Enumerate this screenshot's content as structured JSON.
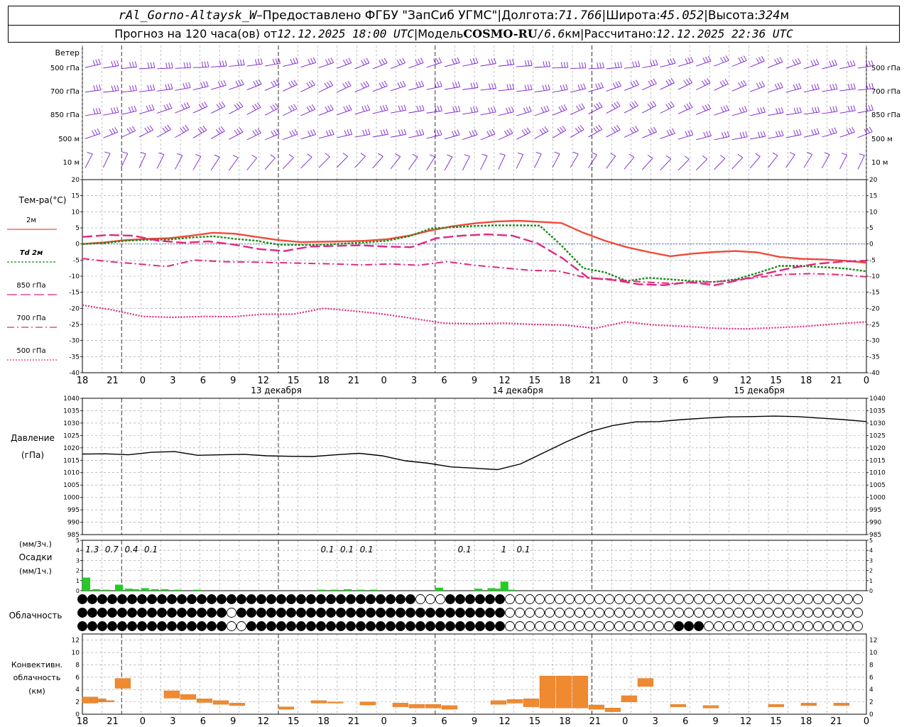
{
  "header": {
    "station": "rAl_Gorno-Altaysk_W",
    "dash": " – ",
    "provider": "Предоставлено ФГБУ \"ЗапСиб УГМС\"",
    "sep": " | ",
    "lon_label": "Долгота: ",
    "lon_value": "71.766",
    "lat_label": "Широта: ",
    "lat_value": "45.052",
    "alt_label": "Высота: ",
    "alt_value": "324",
    "alt_unit": "м",
    "forecast_prefix": "Прогноз на 120 часа(ов) от ",
    "forecast_time": "12.12.2025 18:00 UTC",
    "model_label": "Модель ",
    "model_name": "COSMO-RU",
    "model_res_sep": " / ",
    "model_res": "6.6",
    "model_res_unit": "км",
    "calc_label": "Рассчитано: ",
    "calc_time": "12.12.2025 22:36 UTC"
  },
  "colors": {
    "wind": "#7b1fd1",
    "t2m": "#f04a3a",
    "td2m": "#1a8a1a",
    "t850": "#e0287e",
    "t700": "#e0287e",
    "t500": "#e0287e",
    "pressure": "#000000",
    "precip": "#22cc22",
    "conv": "#f08a30",
    "grid": "#9a9a9a"
  },
  "time_axis": {
    "top_ticks": [
      "18",
      "21",
      "0",
      "3",
      "6",
      "9",
      "12",
      "15",
      "18",
      "21",
      "0",
      "3",
      "6",
      "9",
      "12",
      "15",
      "18",
      "21",
      "0",
      "3",
      "6",
      "9",
      "12",
      "15",
      "18",
      "21",
      "0"
    ],
    "bottom_ticks": [
      "18",
      "21",
      "0",
      "3",
      "6",
      "9",
      "12",
      "15",
      "18",
      "21",
      "0",
      "3",
      "6",
      "9",
      "12",
      "15",
      "18",
      "21",
      "0",
      "3",
      "6",
      "9",
      "12",
      "15",
      "18",
      "21",
      "0"
    ],
    "days": [
      "13 декабря",
      "14 декабря",
      "15 декабря"
    ]
  },
  "chart_data": [
    {
      "type": "wind-barbs",
      "title": "Ветер",
      "levels": [
        "500 гПа",
        "700 гПа",
        "850 гПа",
        "500 м",
        "10 м"
      ],
      "x_hours": [
        0,
        120
      ]
    },
    {
      "type": "line",
      "title": "Тем-ра(°C)",
      "ylim": [
        -40,
        20
      ],
      "yticks": [
        "20",
        "15",
        "10",
        "5",
        "0",
        "-5",
        "-10",
        "-15",
        "-20",
        "-25",
        "-30",
        "-35",
        "-40"
      ],
      "legend": [
        "2м",
        "Td  2м",
        "850 гПа",
        "700 гПа",
        "500 гПа"
      ],
      "x_hours": [
        0,
        3,
        6,
        9,
        12,
        15,
        18,
        21,
        24,
        27,
        30,
        33,
        36,
        39,
        42,
        45,
        48,
        51,
        54,
        57,
        60,
        63,
        66,
        69,
        72,
        75,
        78,
        81,
        84,
        87,
        90,
        93,
        96,
        99,
        102,
        105,
        108,
        111,
        114,
        117,
        120
      ],
      "series": [
        {
          "name": "2м",
          "values": [
            0,
            0.5,
            1.2,
            1.6,
            1.8,
            2.6,
            3.5,
            3.2,
            2.2,
            1.2,
            0.6,
            0.7,
            0.8,
            1.0,
            1.5,
            2.6,
            4.2,
            5.5,
            6.4,
            7.0,
            7.2,
            6.9,
            6.5,
            3.5,
            1.0,
            -1.0,
            -2.5,
            -3.8,
            -3.0,
            -2.5,
            -2.2,
            -2.6,
            -4.0,
            -4.6,
            -4.8,
            -5.2,
            -5.8
          ]
        },
        {
          "name": "Td  2м",
          "values": [
            0,
            0.3,
            1.0,
            1.3,
            1.4,
            2.0,
            2.4,
            1.6,
            1.0,
            -0.2,
            -0.3,
            -0.2,
            0.1,
            0.5,
            1.0,
            2.4,
            4.8,
            5.2,
            5.6,
            5.8,
            5.8,
            5.7,
            -0.5,
            -7.5,
            -8.8,
            -11.5,
            -10.5,
            -11.0,
            -11.5,
            -11.8,
            -11.0,
            -9.0,
            -6.8,
            -6.8,
            -7.2,
            -7.6,
            -8.5
          ]
        },
        {
          "name": "850 гПа",
          "values": [
            2.2,
            2.8,
            2.6,
            1.0,
            0.4,
            0.8,
            -0.2,
            -1.6,
            -2.2,
            -0.8,
            -0.6,
            -0.4,
            -0.8,
            -1.0,
            1.8,
            2.6,
            3.0,
            2.6,
            0.2,
            -4.5,
            -10.5,
            -11.2,
            -12.5,
            -12.8,
            -11.8,
            -12.8,
            -11.2,
            -9.2,
            -7.5,
            -6.2,
            -5.5,
            -5.2
          ]
        },
        {
          "name": "700 гПа",
          "values": [
            -4.5,
            -5.5,
            -6.2,
            -7.0,
            -5.0,
            -5.5,
            -5.6,
            -5.8,
            -6.0,
            -6.2,
            -6.5,
            -6.2,
            -6.6,
            -5.5,
            -6.6,
            -7.4,
            -8.2,
            -8.4,
            -10.5,
            -11.0,
            -11.8,
            -12.2,
            -12.0,
            -11.5,
            -10.5,
            -9.5,
            -9.2,
            -9.5,
            -10.2
          ]
        },
        {
          "name": "500 гПа",
          "values": [
            -19.0,
            -20.5,
            -22.5,
            -22.8,
            -22.5,
            -22.6,
            -21.8,
            -21.8,
            -20.0,
            -20.8,
            -21.8,
            -23.2,
            -24.6,
            -24.8,
            -24.6,
            -25.0,
            -25.2,
            -26.2,
            -24.2,
            -25.2,
            -25.6,
            -26.2,
            -26.4,
            -26.0,
            -25.6,
            -24.8,
            -24.2
          ]
        }
      ]
    },
    {
      "type": "line",
      "title": "Давление",
      "ylabel": "(гПа)",
      "ylim": [
        985,
        1040
      ],
      "yticks": [
        "1040",
        "1035",
        "1030",
        "1025",
        "1020",
        "1015",
        "1010",
        "1005",
        "1000",
        "995",
        "990",
        "985"
      ],
      "x_hours": [
        0,
        3,
        6,
        9,
        12,
        15,
        18,
        21,
        24,
        27,
        30,
        33,
        36,
        39,
        42,
        45,
        48,
        51,
        54,
        57,
        60,
        63,
        66,
        69,
        72,
        75,
        78,
        81,
        84,
        87,
        90,
        93,
        96,
        99,
        102,
        105,
        108,
        111,
        114,
        117,
        120
      ],
      "series": [
        {
          "name": "",
          "values": [
            1017.5,
            1017.6,
            1017.2,
            1018.2,
            1018.5,
            1017.0,
            1017.2,
            1017.4,
            1016.8,
            1016.6,
            1016.5,
            1017.2,
            1017.8,
            1016.8,
            1014.8,
            1013.8,
            1012.3,
            1011.8,
            1011.2,
            1013.5,
            1018.0,
            1022.5,
            1026.5,
            1029.0,
            1030.5,
            1030.6,
            1031.4,
            1032.0,
            1032.5,
            1032.6,
            1032.8,
            1032.6,
            1032.0,
            1031.4,
            1030.6
          ]
        }
      ]
    },
    {
      "type": "bar",
      "title": "Осадки",
      "ylabel_top": "(мм/3ч.)",
      "ylabel_bottom": "(мм/1ч.)",
      "ylim": [
        0,
        5
      ],
      "yticks": [
        "5",
        "4",
        "3",
        "2",
        "1",
        "0"
      ],
      "labels_3h": [
        {
          "hour": 1.5,
          "text": "1.3"
        },
        {
          "hour": 4.5,
          "text": "0.7"
        },
        {
          "hour": 7.5,
          "text": "0.4"
        },
        {
          "hour": 10.5,
          "text": "0.1"
        },
        {
          "hour": 37.5,
          "text": "0.1"
        },
        {
          "hour": 40.5,
          "text": "0.1"
        },
        {
          "hour": 43.5,
          "text": "0.1"
        },
        {
          "hour": 58.5,
          "text": "0.1"
        },
        {
          "hour": 64.5,
          "text": "1"
        },
        {
          "hour": 67.5,
          "text": "0.1"
        }
      ],
      "values_1h": [
        1.3,
        0.2,
        0.1,
        0.15,
        0.1,
        0.6,
        0.2,
        0.25,
        0.2,
        0.3,
        0.2,
        0.2,
        0.15,
        0.1,
        0.05,
        0.05,
        0.1
      ]
    },
    {
      "type": "cloud-cover",
      "title": "Облачность",
      "rows": 3
    },
    {
      "type": "bar",
      "title": "Конвективн.",
      "ylabel": "облачность",
      "yunit": "(км)",
      "ylim": [
        0,
        13
      ],
      "yticks": [
        "12",
        "10",
        "8",
        "6",
        "4",
        "2",
        "0"
      ]
    }
  ]
}
